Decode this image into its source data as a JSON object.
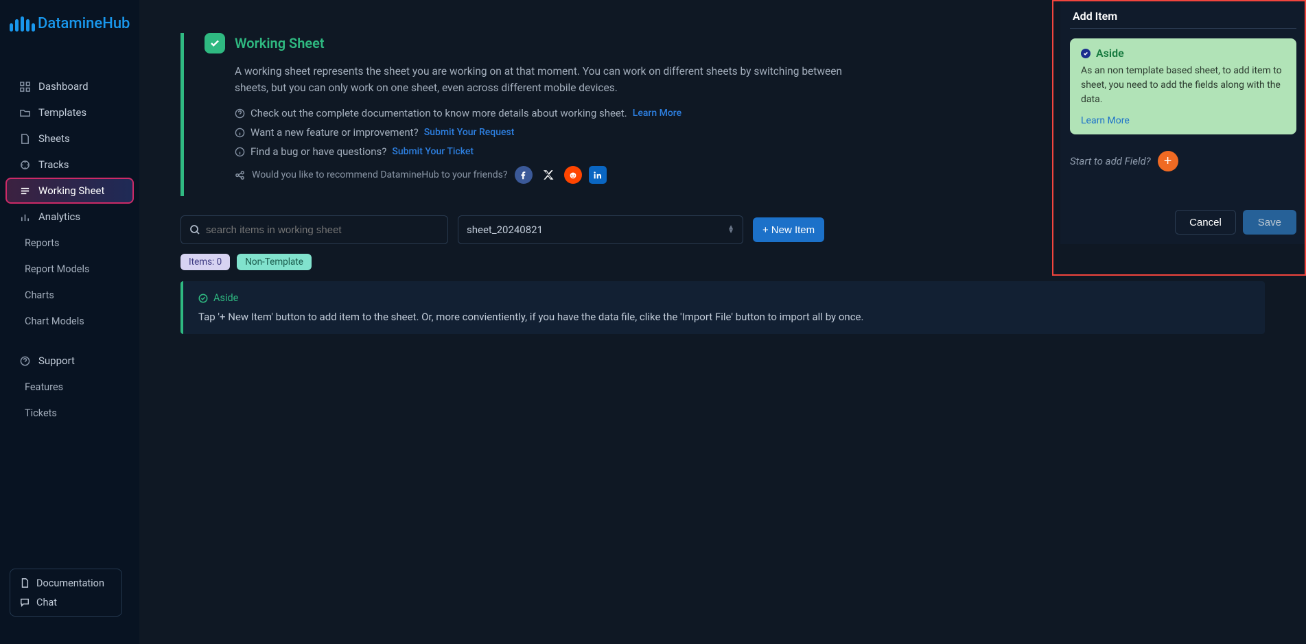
{
  "brand": "DatamineHub",
  "sidebar": {
    "items": [
      {
        "label": "Dashboard"
      },
      {
        "label": "Templates"
      },
      {
        "label": "Sheets"
      },
      {
        "label": "Tracks"
      },
      {
        "label": "Working Sheet"
      },
      {
        "label": "Analytics"
      }
    ],
    "analytics_children": [
      {
        "label": "Reports"
      },
      {
        "label": "Report Models"
      },
      {
        "label": "Charts"
      },
      {
        "label": "Chart Models"
      }
    ],
    "support_label": "Support",
    "support_children": [
      {
        "label": "Features"
      },
      {
        "label": "Tickets"
      }
    ],
    "doc_label": "Documentation",
    "chat_label": "Chat"
  },
  "card": {
    "title": "Working Sheet",
    "desc": "A working sheet represents the sheet you are working on at that moment. You can work on different sheets by switching between sheets, but you can only work on one sheet, even across different mobile devices.",
    "line1": "Check out the complete documentation to know more details about working sheet.",
    "link1": "Learn More",
    "line2": "Want a new feature or improvement?",
    "link2": "Submit Your Request",
    "line3": "Find a bug or have questions?",
    "link3": "Submit Your Ticket",
    "share_text": "Would you like to recommend DatamineHub to your friends?"
  },
  "toolbar": {
    "search_placeholder": "search items in working sheet",
    "sheet_selected": "sheet_20240821",
    "new_item_label": "New Item"
  },
  "tags": {
    "items_tag": "Items: 0",
    "nontpl_tag": "Non-Template"
  },
  "hint": {
    "title": "Aside",
    "body": "Tap '+ New Item' button to add item to the sheet. Or, more convientiently, if you have the data file, clike the 'Import File' button to import all by once."
  },
  "dialog": {
    "title": "Add Item",
    "aside_title": "Aside",
    "aside_body": "As an non template based sheet, to add item to sheet, you need to add the fields along with the data.",
    "aside_link": "Learn More",
    "addfield_label": "Start to add Field?",
    "cancel": "Cancel",
    "save": "Save"
  }
}
